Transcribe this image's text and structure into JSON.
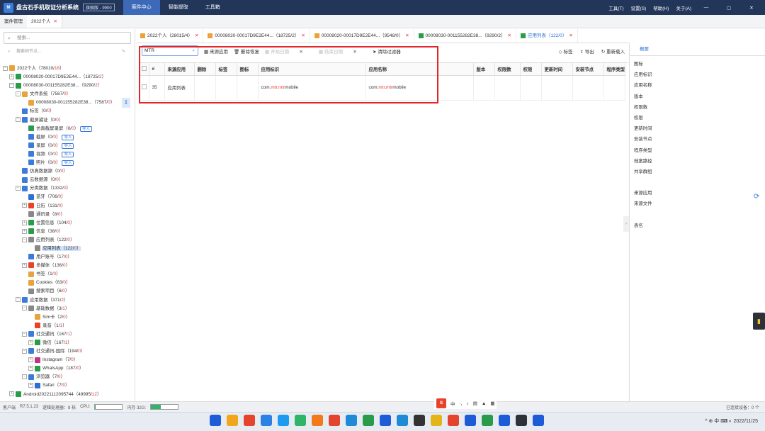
{
  "app": {
    "logo": "M",
    "title": "盘古石手机取证分析系统",
    "version": "旗舰版 - 9900",
    "nav": [
      "案件中心",
      "智能提取",
      "工具箱"
    ],
    "menu": [
      "工具(T)",
      "设置(S)",
      "帮助(H)",
      "关于(A)"
    ],
    "win": [
      "—",
      "▢",
      "✕"
    ]
  },
  "case_tabs": [
    {
      "label": "案件管理"
    },
    {
      "label": "2022个人",
      "close": "✕"
    }
  ],
  "left": {
    "search_placeholder": "搜索...",
    "node_search_placeholder": "搜索树节点...",
    "tree": [
      {
        "indent": 0,
        "exp": "−",
        "label": "2022个人",
        "count": "78010",
        "red": "16",
        "color": "#e8a33b"
      },
      {
        "indent": 1,
        "exp": "+",
        "label": "00008020-00017D9E2E44...",
        "count": "18725",
        "red": "2",
        "color": "#2a9b4b"
      },
      {
        "indent": 1,
        "exp": "−",
        "label": "00008030-001155282E38...",
        "count": "9290",
        "red": "2",
        "color": "#2a9b4b"
      },
      {
        "indent": 2,
        "exp": "−",
        "label": "文件系统",
        "count": "7587",
        "red": "0",
        "color": "#e8a33b"
      },
      {
        "indent": 3,
        "exp": "",
        "label": "00008030-001155282E38...",
        "count": "7587",
        "red": "0",
        "color": "#e8a33b"
      },
      {
        "indent": 2,
        "exp": "",
        "label": "标签",
        "count": "0",
        "red": "0",
        "color": "#3b7bd9"
      },
      {
        "indent": 2,
        "exp": "−",
        "label": "截屏捕证",
        "count": "0",
        "red": "0",
        "color": "#3b7bd9"
      },
      {
        "indent": 3,
        "exp": "",
        "label": "仿真截屏录屏",
        "count": "0",
        "red": "0",
        "color": "#2a9b4b",
        "imp": "导入"
      },
      {
        "indent": 3,
        "exp": "",
        "label": "截屏",
        "count": "0",
        "red": "0",
        "color": "#3b7bd9",
        "imp": "导入"
      },
      {
        "indent": 3,
        "exp": "",
        "label": "录屏",
        "count": "0",
        "red": "0",
        "color": "#3b7bd9",
        "imp": "导入"
      },
      {
        "indent": 3,
        "exp": "",
        "label": "视频",
        "count": "0",
        "red": "0",
        "color": "#3b7bd9",
        "imp": "导入"
      },
      {
        "indent": 3,
        "exp": "",
        "label": "照片",
        "count": "0",
        "red": "0",
        "color": "#3b7bd9",
        "imp": "导入"
      },
      {
        "indent": 2,
        "exp": "",
        "label": "仿真数据源",
        "count": "0",
        "red": "0",
        "color": "#3b7bd9"
      },
      {
        "indent": 2,
        "exp": "",
        "label": "云数据源",
        "count": "0",
        "red": "0",
        "color": "#3b7bd9"
      },
      {
        "indent": 2,
        "exp": "−",
        "label": "分类数据",
        "count": "1332",
        "red": "0",
        "color": "#3b7bd9"
      },
      {
        "indent": 3,
        "exp": "",
        "label": "蓝牙",
        "count": "706",
        "red": "0",
        "color": "#2b6fd6"
      },
      {
        "indent": 3,
        "exp": "+",
        "label": "日历",
        "count": "131",
        "red": "0",
        "color": "#e8412c"
      },
      {
        "indent": 3,
        "exp": "",
        "label": "通讯录",
        "count": "8",
        "red": "0",
        "color": "#888"
      },
      {
        "indent": 3,
        "exp": "+",
        "label": "位置信息",
        "count": "104",
        "red": "0",
        "color": "#2a9b4b"
      },
      {
        "indent": 3,
        "exp": "+",
        "label": "信息",
        "count": "38",
        "red": "0",
        "color": "#2a9b4b"
      },
      {
        "indent": 3,
        "exp": "−",
        "label": "应用列表",
        "count": "122",
        "red": "0",
        "color": "#888"
      },
      {
        "indent": 4,
        "exp": "",
        "label": "应用列表",
        "count": "122",
        "red": "0",
        "color": "#888",
        "sel": true
      },
      {
        "indent": 3,
        "exp": "",
        "label": "用户账号",
        "count": "17",
        "red": "0",
        "color": "#3b7bd9"
      },
      {
        "indent": 3,
        "exp": "+",
        "label": "多媒体",
        "count": "136",
        "red": "0",
        "color": "#e8412c"
      },
      {
        "indent": 3,
        "exp": "",
        "label": "书签",
        "count": "1",
        "red": "0",
        "color": "#e8a33b"
      },
      {
        "indent": 3,
        "exp": "",
        "label": "Cookies",
        "count": "63",
        "red": "0",
        "color": "#e8a33b"
      },
      {
        "indent": 3,
        "exp": "",
        "label": "搜索项目",
        "count": "6",
        "red": "0",
        "color": "#888"
      },
      {
        "indent": 2,
        "exp": "−",
        "label": "应用数据",
        "count": "371",
        "red": "2",
        "color": "#3b7bd9"
      },
      {
        "indent": 3,
        "exp": "−",
        "label": "基础数据",
        "count": "3",
        "red": "1",
        "color": "#888"
      },
      {
        "indent": 4,
        "exp": "",
        "label": "Sim卡",
        "count": "2",
        "red": "0",
        "color": "#e8a33b"
      },
      {
        "indent": 4,
        "exp": "",
        "label": "录音",
        "count": "1",
        "red": "1",
        "color": "#e8412c"
      },
      {
        "indent": 3,
        "exp": "−",
        "label": "社交通讯",
        "count": "167",
        "red": "1",
        "color": "#3b7bd9"
      },
      {
        "indent": 4,
        "exp": "+",
        "label": "微信",
        "count": "167",
        "red": "1",
        "color": "#2a9b4b"
      },
      {
        "indent": 3,
        "exp": "−",
        "label": "社交通讯-国际",
        "count": "194",
        "red": "0",
        "color": "#3b7bd9"
      },
      {
        "indent": 4,
        "exp": "+",
        "label": "Instagram",
        "count": "7",
        "red": "0",
        "color": "#c13584"
      },
      {
        "indent": 4,
        "exp": "+",
        "label": "WhatsApp",
        "count": "187",
        "red": "0",
        "color": "#2a9b4b"
      },
      {
        "indent": 3,
        "exp": "−",
        "label": "浏览器",
        "count": "7",
        "red": "0",
        "color": "#3b7bd9"
      },
      {
        "indent": 4,
        "exp": "+",
        "label": "Safari",
        "count": "7",
        "red": "0",
        "color": "#2b6fd6"
      },
      {
        "indent": 1,
        "exp": "+",
        "label": "Android20221112095744",
        "count": "49995",
        "red": "12",
        "color": "#2a9b4b"
      }
    ]
  },
  "content_tabs": [
    {
      "label": "2022个人（28015/4）",
      "icon": "folder"
    },
    {
      "label": "00008020-00017D9E2E44...（18725/2）",
      "icon": "folder"
    },
    {
      "label": "00008020-00017D9E2E44...（9548/0）",
      "icon": "folder"
    },
    {
      "label": "00008030-001155282E38...（9290/2）",
      "icon": "phone"
    },
    {
      "label": "应用列表（122/0）",
      "icon": "phone",
      "active": true
    }
  ],
  "toolbar": {
    "search_value": "MTR",
    "source_app": "来源应用",
    "delete_restore": "删除恢复",
    "start_date": "开始日期",
    "end_date": "结束日期",
    "clear_filter": "清除过滤器",
    "tag": "标签",
    "export": "导出",
    "reload": "重新载入"
  },
  "table": {
    "columns": [
      "#",
      "来源应用",
      "删除",
      "标签",
      "图标",
      "应用标识",
      "应用名称",
      "版本",
      "权限数",
      "权限",
      "更新时间",
      "安装节点",
      "程序类型"
    ],
    "rows": [
      {
        "num": "35",
        "source": "应用列表",
        "id_pre": "com.",
        "id_mid": "mtr",
        "id_dot": ".",
        "id_mid2": "mtr",
        "id_post": "mobile"
      }
    ]
  },
  "right_panel": {
    "tab": "概要",
    "fields": [
      "图标",
      "应用标识",
      "应用名称",
      "版本",
      "权限数",
      "权限",
      "更新时间",
      "安装节点",
      "程序类型",
      "档案路径",
      "共享群组",
      "",
      "来源应用",
      "来源文件",
      "",
      "表名"
    ]
  },
  "status": {
    "client": "客户端",
    "version": "R7.5.1.23",
    "cores": "逻辑处理器：8 核",
    "cpu_label": "CPU:",
    "cpu_pct": 0.02,
    "mem_label": "内存 32G:",
    "mem_pct": 0.36,
    "right": "已连接设备：0 个"
  },
  "taskbar": {
    "tray": "^ ⊕ 中  ⌨ ◐ 2022/11/25"
  }
}
